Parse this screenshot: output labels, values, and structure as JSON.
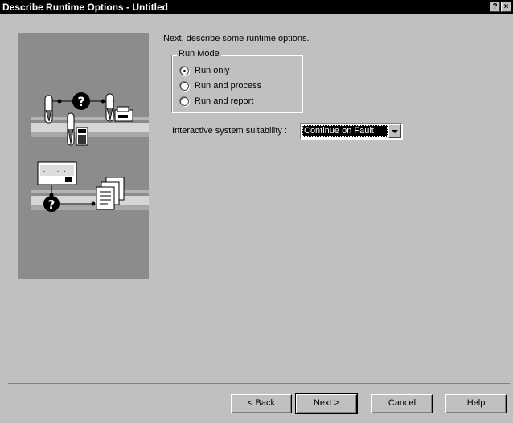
{
  "window": {
    "title": "Describe Runtime Options - Untitled",
    "help_glyph": "?",
    "close_glyph": "×"
  },
  "intro": "Next, describe some runtime options.",
  "run_mode": {
    "legend": "Run Mode",
    "options": [
      {
        "label": "Run only",
        "checked": true
      },
      {
        "label": "Run and process",
        "checked": false
      },
      {
        "label": "Run and report",
        "checked": false
      }
    ]
  },
  "suitability": {
    "label": "Interactive system suitability :",
    "value": "Continue on Fault"
  },
  "buttons": {
    "back": "< Back",
    "next": "Next >",
    "cancel": "Cancel",
    "help": "Help"
  },
  "colors": {
    "face": "#c0c0c0",
    "illustration_bg": "#8c8c8c",
    "titlebar": "#000000"
  }
}
